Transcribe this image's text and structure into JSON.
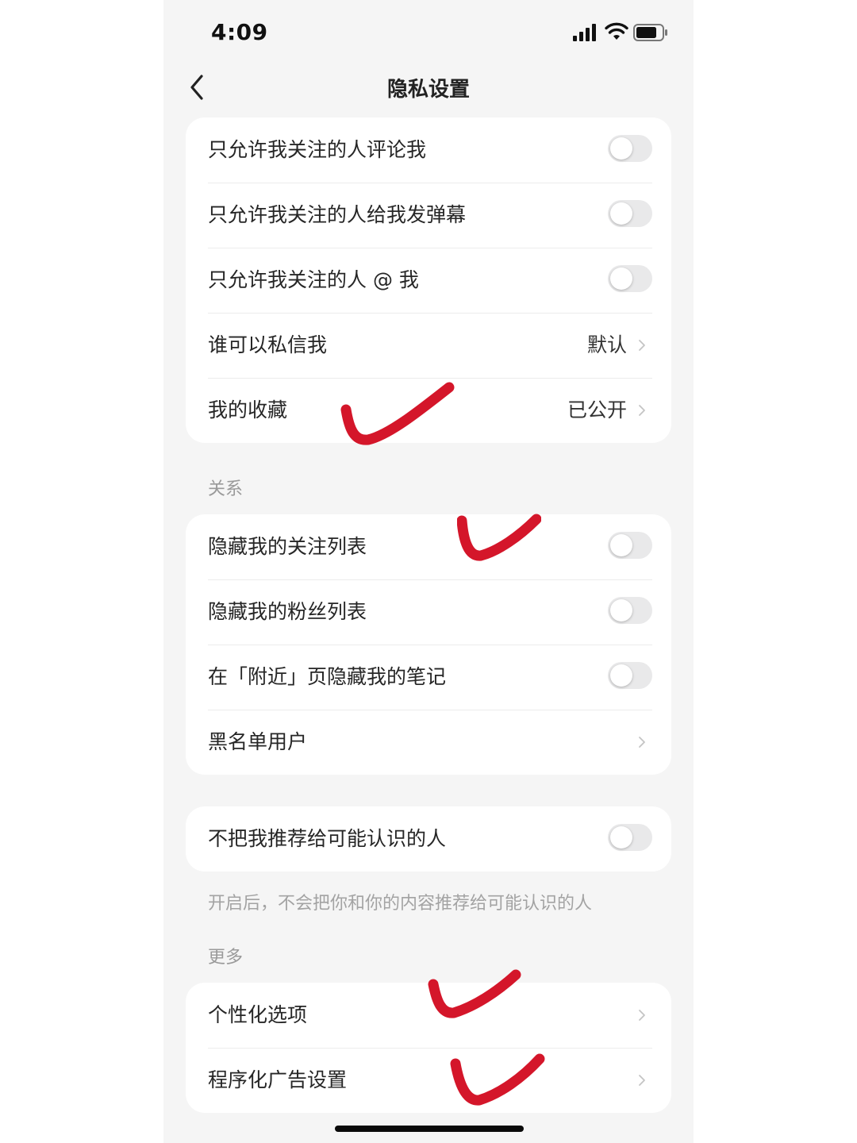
{
  "status_bar": {
    "time": "4:09"
  },
  "header": {
    "title": "隐私设置"
  },
  "group1": {
    "items": [
      {
        "label": "只允许我关注的人评论我",
        "type": "toggle",
        "on": false
      },
      {
        "label": "只允许我关注的人给我发弹幕",
        "type": "toggle",
        "on": false
      },
      {
        "label": "只允许我关注的人 @ 我",
        "type": "toggle",
        "on": false
      },
      {
        "label": "谁可以私信我",
        "type": "link",
        "value": "默认"
      },
      {
        "label": "我的收藏",
        "type": "link",
        "value": "已公开"
      }
    ]
  },
  "relation": {
    "header": "关系",
    "items": [
      {
        "label": "隐藏我的关注列表",
        "type": "toggle",
        "on": false
      },
      {
        "label": "隐藏我的粉丝列表",
        "type": "toggle",
        "on": false
      },
      {
        "label": "在「附近」页隐藏我的笔记",
        "type": "toggle",
        "on": false
      },
      {
        "label": "黑名单用户",
        "type": "link"
      }
    ]
  },
  "recommend": {
    "label": "不把我推荐给可能认识的人",
    "on": false,
    "note": "开启后，不会把你和你的内容推荐给可能认识的人"
  },
  "more": {
    "header": "更多",
    "items": [
      {
        "label": "个性化选项",
        "type": "link"
      },
      {
        "label": "程序化广告设置",
        "type": "link"
      }
    ]
  },
  "colors": {
    "annotation_check": "#d4162a",
    "toggle_off": "#e9e9ea",
    "background": "#f5f5f5"
  },
  "annotations": [
    "checkmark",
    "checkmark",
    "checkmark",
    "checkmark"
  ]
}
